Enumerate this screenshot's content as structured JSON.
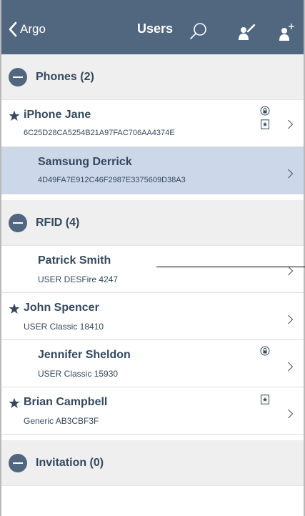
{
  "navbar": {
    "back_label": "Argo",
    "title": "Users",
    "icons": [
      "search-icon",
      "assign-key-icon",
      "add-user-icon"
    ],
    "background": "#50677f"
  },
  "sections": [
    {
      "title": "Phones (2)"
    },
    {
      "title": "RFID (4)"
    },
    {
      "title": "Invitation (0)"
    }
  ],
  "phones": [
    {
      "name": "iPhone Jane",
      "sub": "6C25D28CA5254B21A97FAC706AA4374E",
      "starred": true,
      "icons": [
        "lock-icon",
        "card-star-icon"
      ]
    },
    {
      "name": "Samsung Derrick",
      "sub": "4D49FA7E912C46F2987E3375609D38A3",
      "starred": false,
      "selected": true
    }
  ],
  "rfid": [
    {
      "name": "Patrick Smith",
      "sub": "USER DESFire 4247",
      "starred": false
    },
    {
      "name": "John Spencer",
      "sub": "USER Classic 18410",
      "starred": true
    },
    {
      "name": "Jennifer Sheldon",
      "sub": "USER Classic 15930",
      "starred": false,
      "icons": [
        "lock-icon"
      ]
    },
    {
      "name": "Brian Campbell",
      "sub": "Generic AB3CBF3F",
      "starred": true,
      "icons": [
        "card-star-icon"
      ]
    }
  ],
  "colors": {
    "selected_row": "#cdd7ea",
    "section_bg": "#efefef",
    "text": "#34495e"
  }
}
